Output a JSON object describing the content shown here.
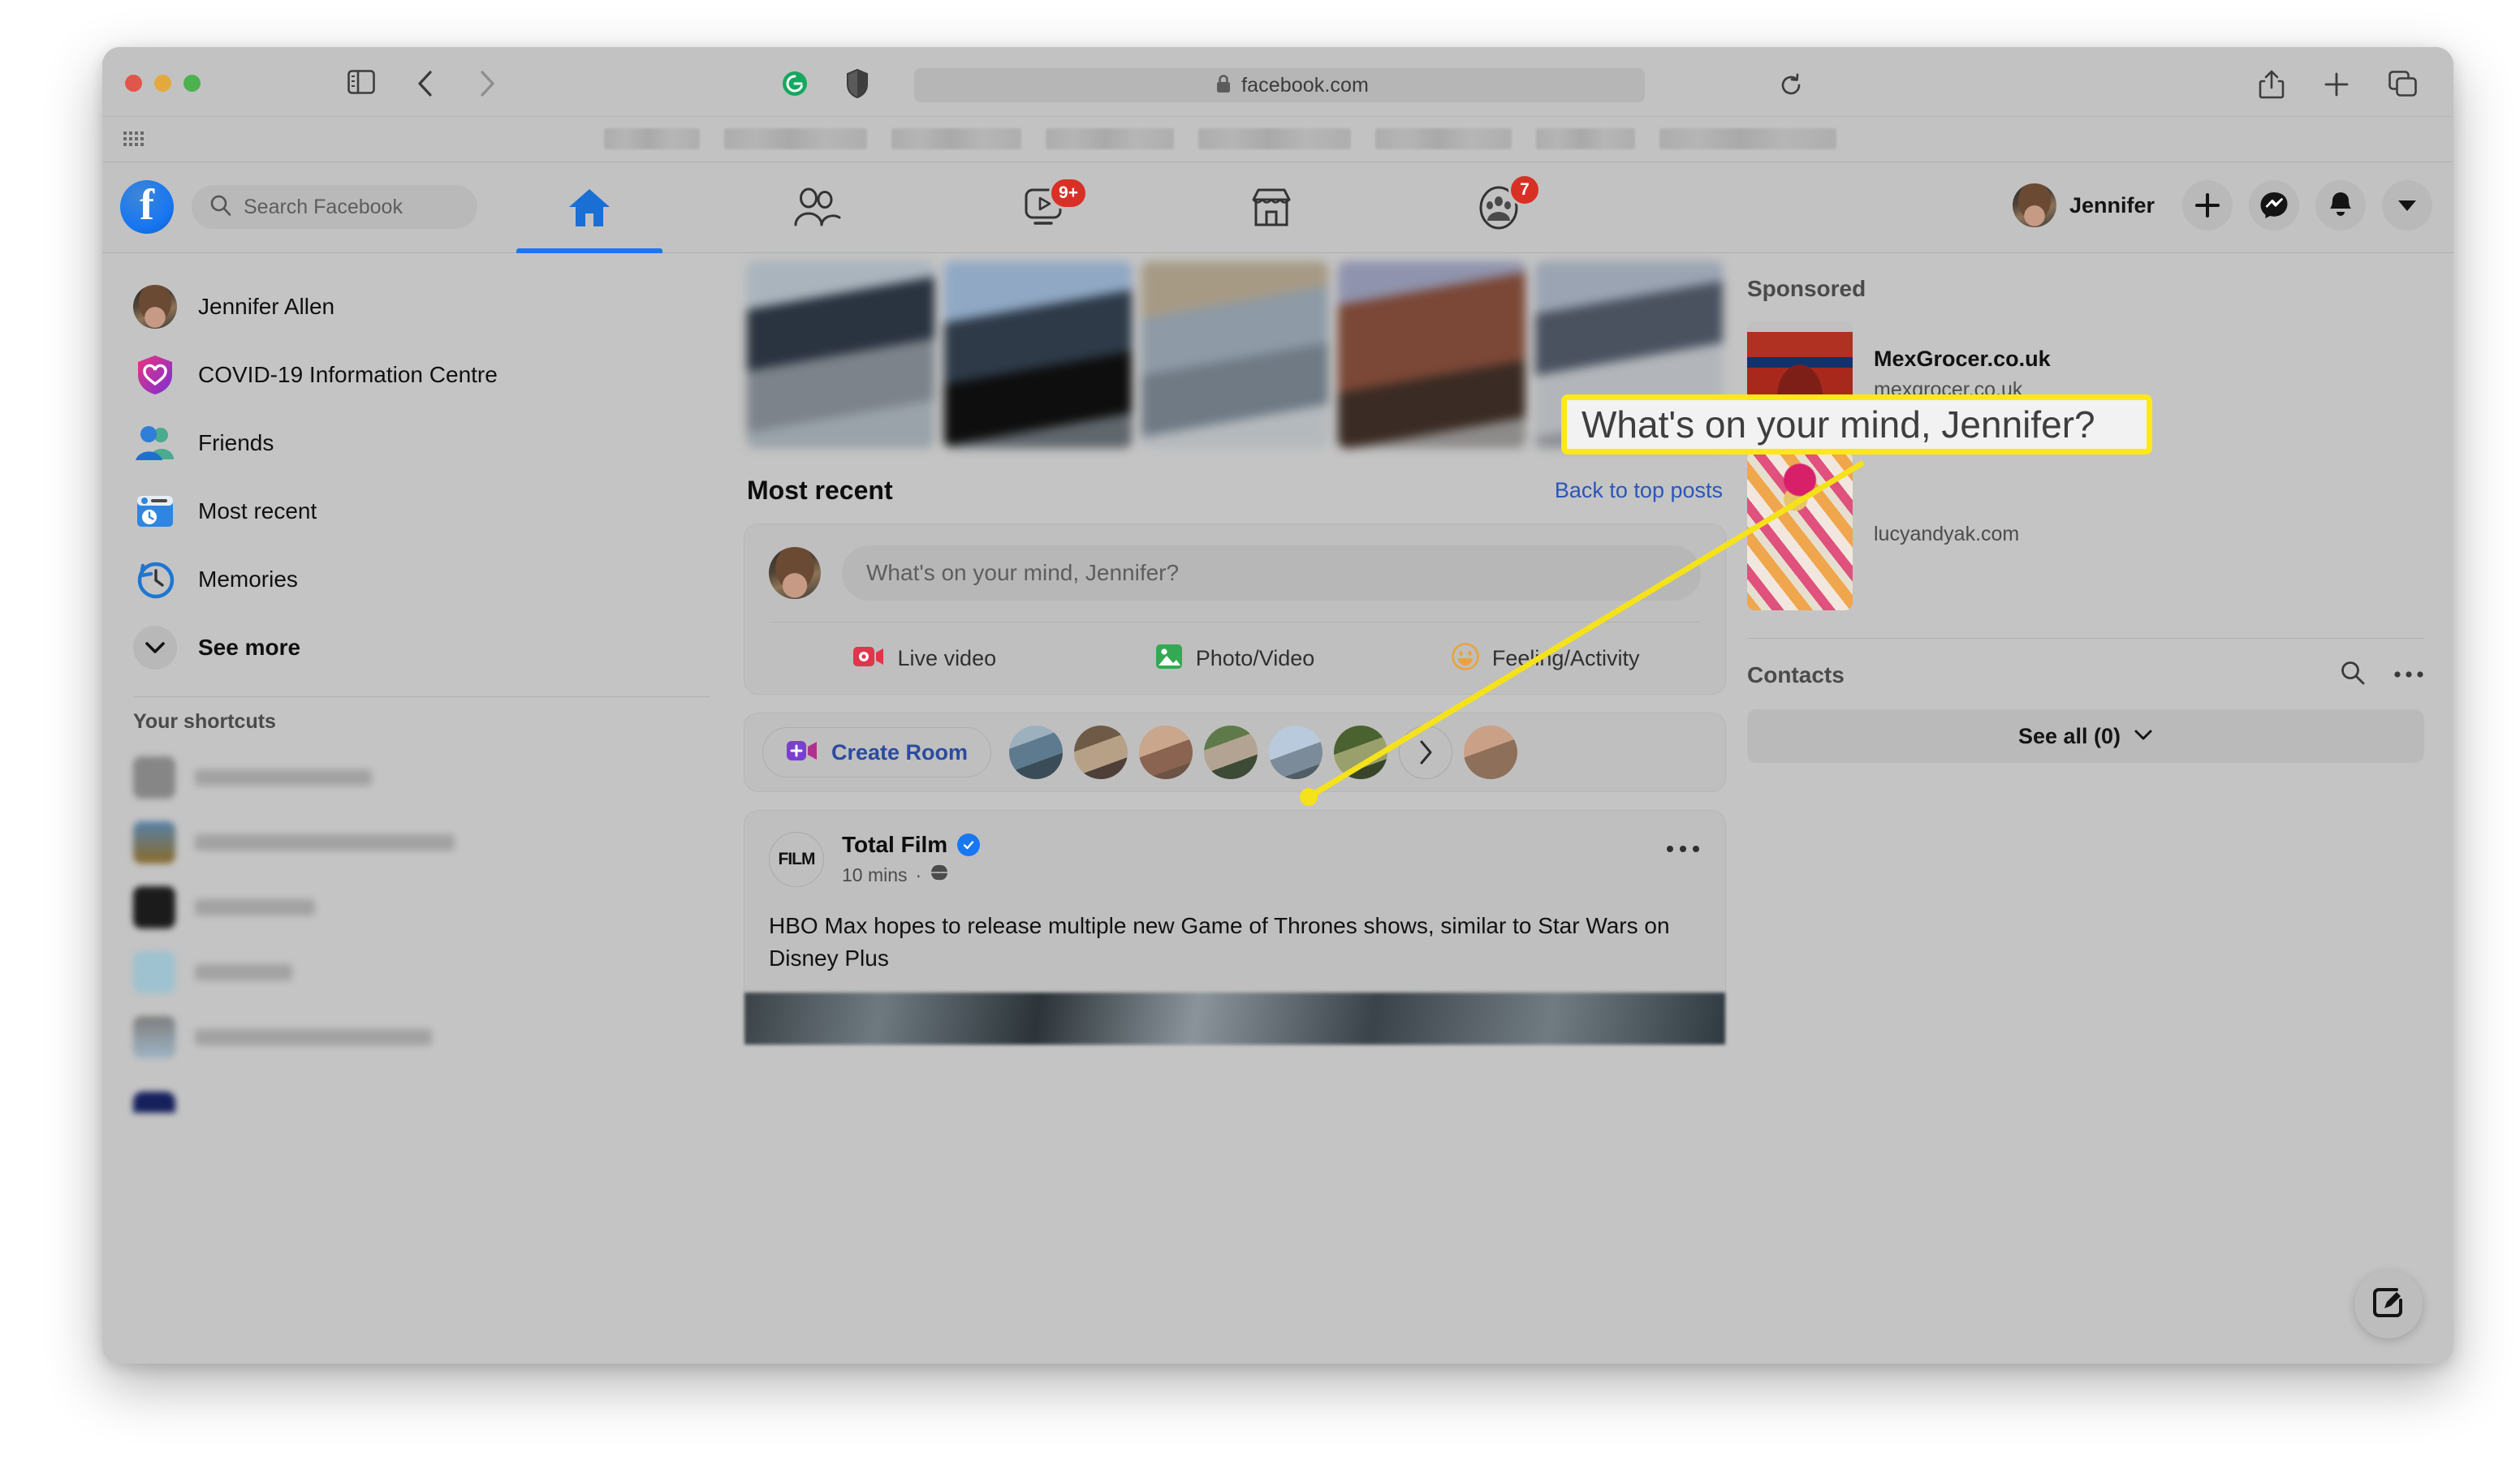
{
  "browser": {
    "url": "facebook.com",
    "traffic_lights": [
      "close",
      "minimize",
      "zoom"
    ],
    "icons": {
      "sidebar_toggle": "sidebar-toggle-icon",
      "back": "nav-back-icon",
      "forward": "nav-forward-icon",
      "grammarly": "grammarly-icon",
      "shield": "privacy-shield-icon",
      "lock": "lock-icon",
      "reload": "reload-icon",
      "share": "share-icon",
      "new_tab": "plus-icon",
      "tab_overview": "tab-overview-icon",
      "bookmarks_grid": "grid-icon"
    }
  },
  "fb_nav": {
    "logo_letter": "f",
    "search_placeholder": "Search Facebook",
    "tabs": [
      {
        "name": "home",
        "icon": "home-icon",
        "active": true,
        "badge": null
      },
      {
        "name": "friends",
        "icon": "friends-icon",
        "active": false,
        "badge": null
      },
      {
        "name": "watch",
        "icon": "watch-icon",
        "active": false,
        "badge": "9+"
      },
      {
        "name": "marketplace",
        "icon": "marketplace-icon",
        "active": false,
        "badge": null
      },
      {
        "name": "groups",
        "icon": "groups-icon",
        "active": false,
        "badge": "7"
      }
    ],
    "account_name": "Jennifer",
    "right_buttons": [
      {
        "name": "create",
        "icon": "plus-icon"
      },
      {
        "name": "messenger",
        "icon": "messenger-icon"
      },
      {
        "name": "notifications",
        "icon": "bell-icon"
      },
      {
        "name": "account-menu",
        "icon": "chevron-down-icon"
      }
    ]
  },
  "left_sidebar": {
    "items": [
      {
        "label": "Jennifer Allen",
        "icon": "profile-avatar"
      },
      {
        "label": "COVID-19 Information Centre",
        "icon": "covid-shield-icon"
      },
      {
        "label": "Friends",
        "icon": "friends-icon"
      },
      {
        "label": "Most recent",
        "icon": "most-recent-icon"
      },
      {
        "label": "Memories",
        "icon": "memories-clock-icon"
      },
      {
        "label": "See more",
        "icon": "chevron-down-icon"
      }
    ],
    "shortcuts_title": "Your shortcuts",
    "shortcuts": [
      {
        "label": "",
        "blurred": true
      },
      {
        "label": "",
        "blurred": true
      },
      {
        "label": "",
        "blurred": true
      },
      {
        "label": "",
        "blurred": true
      },
      {
        "label": "",
        "blurred": true
      }
    ]
  },
  "feed": {
    "stories_count": 5,
    "heading": "Most recent",
    "back_link": "Back to top posts",
    "composer": {
      "placeholder": "What's on your mind, Jennifer?",
      "actions": [
        {
          "label": "Live video",
          "icon": "live-video-icon",
          "color": "#e0354b"
        },
        {
          "label": "Photo/Video",
          "icon": "photo-video-icon",
          "color": "#36a853"
        },
        {
          "label": "Feeling/Activity",
          "icon": "feeling-activity-icon",
          "color": "#e9a33b"
        }
      ]
    },
    "rooms": {
      "create_label": "Create Room",
      "icon": "create-room-icon",
      "avatar_count": 7,
      "next_icon": "chevron-right-icon"
    },
    "post": {
      "page_name": "Total Film",
      "logo_text": "FILM",
      "verified": true,
      "time": "10 mins",
      "audience_icon": "globe-icon",
      "menu_icon": "ellipsis-icon",
      "text": "HBO Max hopes to release multiple new Game of Thrones shows, similar to Star Wars on Disney Plus"
    }
  },
  "right_sidebar": {
    "sponsored_title": "Sponsored",
    "ads": [
      {
        "title": "MexGrocer.co.uk",
        "url": "mexgrocer.co.uk",
        "thumb": "salsa-jar-image"
      },
      {
        "title": "",
        "url": "lucyandyak.com",
        "thumb": "fashion-model-image"
      }
    ],
    "contacts": {
      "title": "Contacts",
      "search_icon": "search-icon",
      "more_icon": "ellipsis-icon",
      "see_all_label": "See all (0)",
      "see_all_chevron": "chevron-down-icon"
    },
    "compose_fab": "compose-message-icon"
  },
  "annotation": {
    "callout_text": "What's on your mind, Jennifer?",
    "border_color": "#ffe818",
    "line_color": "#f5e21a",
    "target": "composer-input"
  }
}
